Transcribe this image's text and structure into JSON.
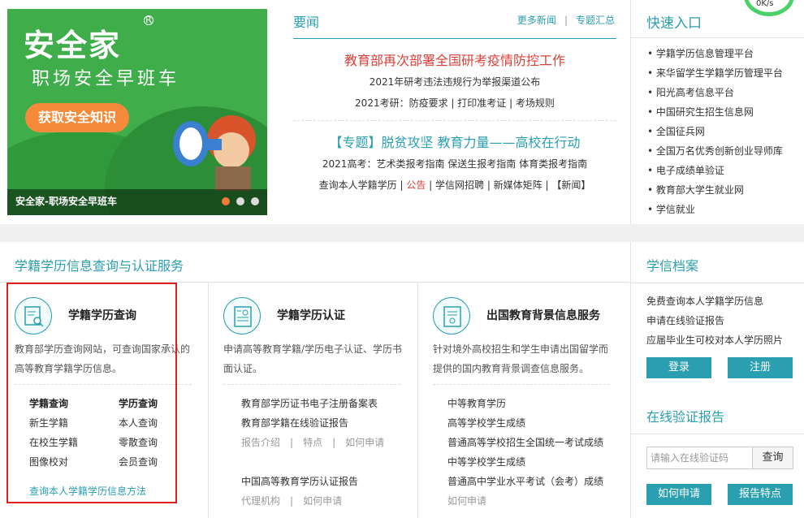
{
  "banner": {
    "brand": "安全家",
    "reg_mark": "R",
    "slogan": "职场安全早班车",
    "cta": "获取安全知识",
    "caption": "安全家-职场安全早班车"
  },
  "speed": {
    "text": "0K/s"
  },
  "news": {
    "title": "要闻",
    "more": "更多新闻",
    "sep": "|",
    "topics": "专题汇总",
    "headline": "教育部再次部署全国研考疫情防控工作",
    "line1": "2021年研考违法违规行为举报渠道公布",
    "line2": "2021考研：防疫要求 | 打印准考证 | 考场规则",
    "headline2": "【专题】脱贫攻坚 教育力量——高校在行动",
    "line3": "2021高考：艺术类报考指南 保送生报考指南 体育类报考指南",
    "line4_a": "查询本人学籍学历 | ",
    "line4_red": "公告",
    "line4_b": " | 学信网招聘 | 新媒体矩阵 | 【新闻】"
  },
  "quick": {
    "title": "快速入口",
    "items": [
      "学籍学历信息管理平台",
      "来华留学生学籍学历管理平台",
      "阳光高考信息平台",
      "中国研究生招生信息网",
      "全国征兵网",
      "全国万名优秀创新创业导师库",
      "电子成绩单验证",
      "教育部大学生就业网",
      "学信就业"
    ]
  },
  "services": {
    "title": "学籍学历信息查询与认证服务",
    "col1": {
      "title": "学籍学历查询",
      "desc": "教育部学历查询网站，可查询国家承认的高等教育学籍学历信息。",
      "h1": "学籍查询",
      "h2": "学历查询",
      "a1": "新生学籍",
      "a2": "在校生学籍",
      "a3": "图像校对",
      "b1": "本人查询",
      "b2": "零散查询",
      "b3": "会员查询",
      "method": "查询本人学籍学历信息方法"
    },
    "col2": {
      "title": "学籍学历认证",
      "desc": "申请高等教育学籍/学历电子认证、学历书面认证。",
      "l1": "教育部学历证书电子注册备案表",
      "l2": "教育部学籍在线验证报告",
      "s1": "报告介绍",
      "s2": "特点",
      "s3": "如何申请",
      "sep": "|",
      "l3": "中国高等教育学历认证报告",
      "s4": "代理机构",
      "s5": "如何申请"
    },
    "col3": {
      "title": "出国教育背景信息服务",
      "desc": "针对境外高校招生和学生申请出国留学而提供的国内教育背景调查信息服务。",
      "l1": "中等教育学历",
      "l2": "高等学校学生成绩",
      "l3": "普通高等学校招生全国统一考试成绩",
      "l4": "中等学校学生成绩",
      "l5": "普通高中学业水平考试（会考）成绩",
      "l6": "如何申请"
    }
  },
  "archive": {
    "title": "学信档案",
    "link1": "免费查询本人学籍学历信息",
    "link2": "申请在线验证报告",
    "link3": "应届毕业生可校对本人学历照片",
    "login": "登录",
    "register": "注册",
    "verify_title": "在线验证报告",
    "placeholder": "请输入在线验证码",
    "query": "查询",
    "how": "如何申请",
    "features": "报告特点"
  },
  "colors": {
    "accent": "#2a9fb0",
    "headline_red": "#d9413a",
    "highlight": "#e02020",
    "banner_green": "#3fae4a"
  }
}
